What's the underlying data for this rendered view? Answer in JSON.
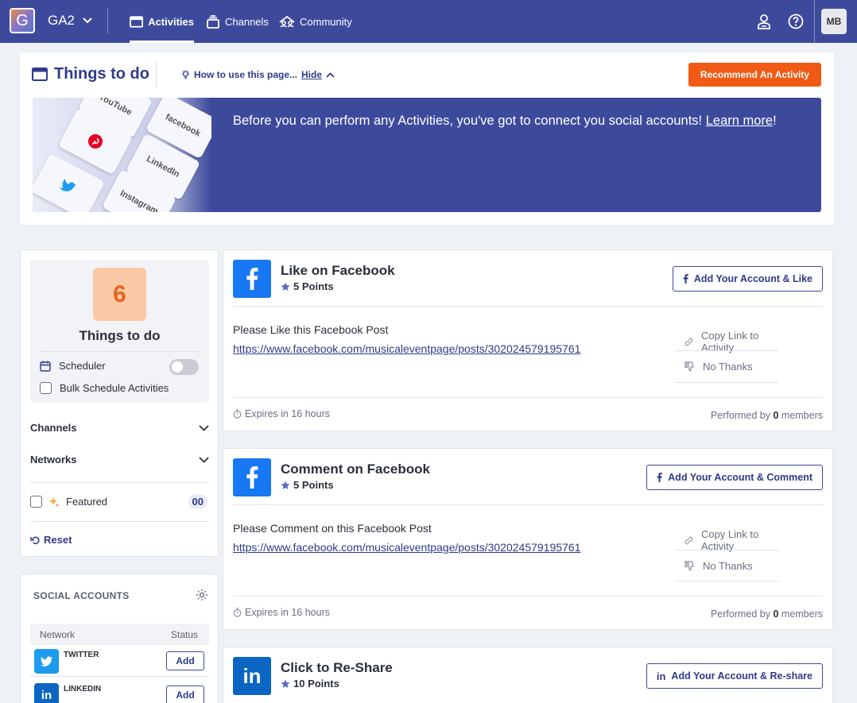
{
  "nav": {
    "logo_letter": "G",
    "org_name": "GA2",
    "tabs": [
      {
        "label": "Activities",
        "icon": "browser-window-icon",
        "active": true
      },
      {
        "label": "Channels",
        "icon": "stack-icon",
        "active": false
      },
      {
        "label": "Community",
        "icon": "community-icon",
        "active": false
      }
    ],
    "avatar_initials": "MB"
  },
  "header": {
    "title": "Things to do",
    "howto_label": "How to use this page...",
    "hide_label": "Hide",
    "recommend_label": "Recommend An Activity",
    "banner_text": "Before you can perform any Activities, you've got to connect you social accounts!",
    "learn_more": "Learn more",
    "banner_end": "!",
    "banner_keys": [
      "YouTube",
      "facebook",
      "LinkedIn",
      "Instagram"
    ]
  },
  "filters": {
    "count": "6",
    "count_label": "Things to do",
    "scheduler_label": "Scheduler",
    "bulk_label": "Bulk Schedule Activities",
    "channels_label": "Channels",
    "networks_label": "Networks",
    "featured_label": "Featured",
    "featured_count": "00",
    "reset_label": "Reset"
  },
  "social": {
    "title": "SOCIAL ACCOUNTS",
    "col_network": "Network",
    "col_status": "Status",
    "accounts": [
      {
        "name": "TWITTER",
        "action": "Add",
        "color": "#1d9bf0"
      },
      {
        "name": "LINKEDIN",
        "action": "Add",
        "color": "#0a66c2"
      }
    ]
  },
  "activities": [
    {
      "title": "Like on Facebook",
      "points": "5 Points",
      "button": "Add Your Account & Like",
      "description": "Please Like this Facebook Post",
      "link": "https://www.facebook.com/musicaleventpage/posts/302024579195761",
      "copy_label": "Copy Link to Activity",
      "no_thanks_label": "No Thanks",
      "expires": "Expires in 16 hours",
      "performed_prefix": "Performed by",
      "performed_count": "0",
      "performed_suffix": "members"
    },
    {
      "title": "Comment on Facebook",
      "points": "5 Points",
      "button": "Add Your Account & Comment",
      "description": "Please Comment on this Facebook Post",
      "link": "https://www.facebook.com/musicaleventpage/posts/302024579195761",
      "copy_label": "Copy Link to Activity",
      "no_thanks_label": "No Thanks",
      "expires": "Expires in 16 hours",
      "performed_prefix": "Performed by",
      "performed_count": "0",
      "performed_suffix": "members"
    },
    {
      "title": "Click to Re-Share",
      "points": "10 Points",
      "button": "Add Your Account & Re-share"
    }
  ],
  "colors": {
    "nav_bg": "#3d4a9c",
    "accent_orange": "#f05a14",
    "facebook_blue": "#1877f2",
    "linkedin_blue": "#0a66c2"
  }
}
